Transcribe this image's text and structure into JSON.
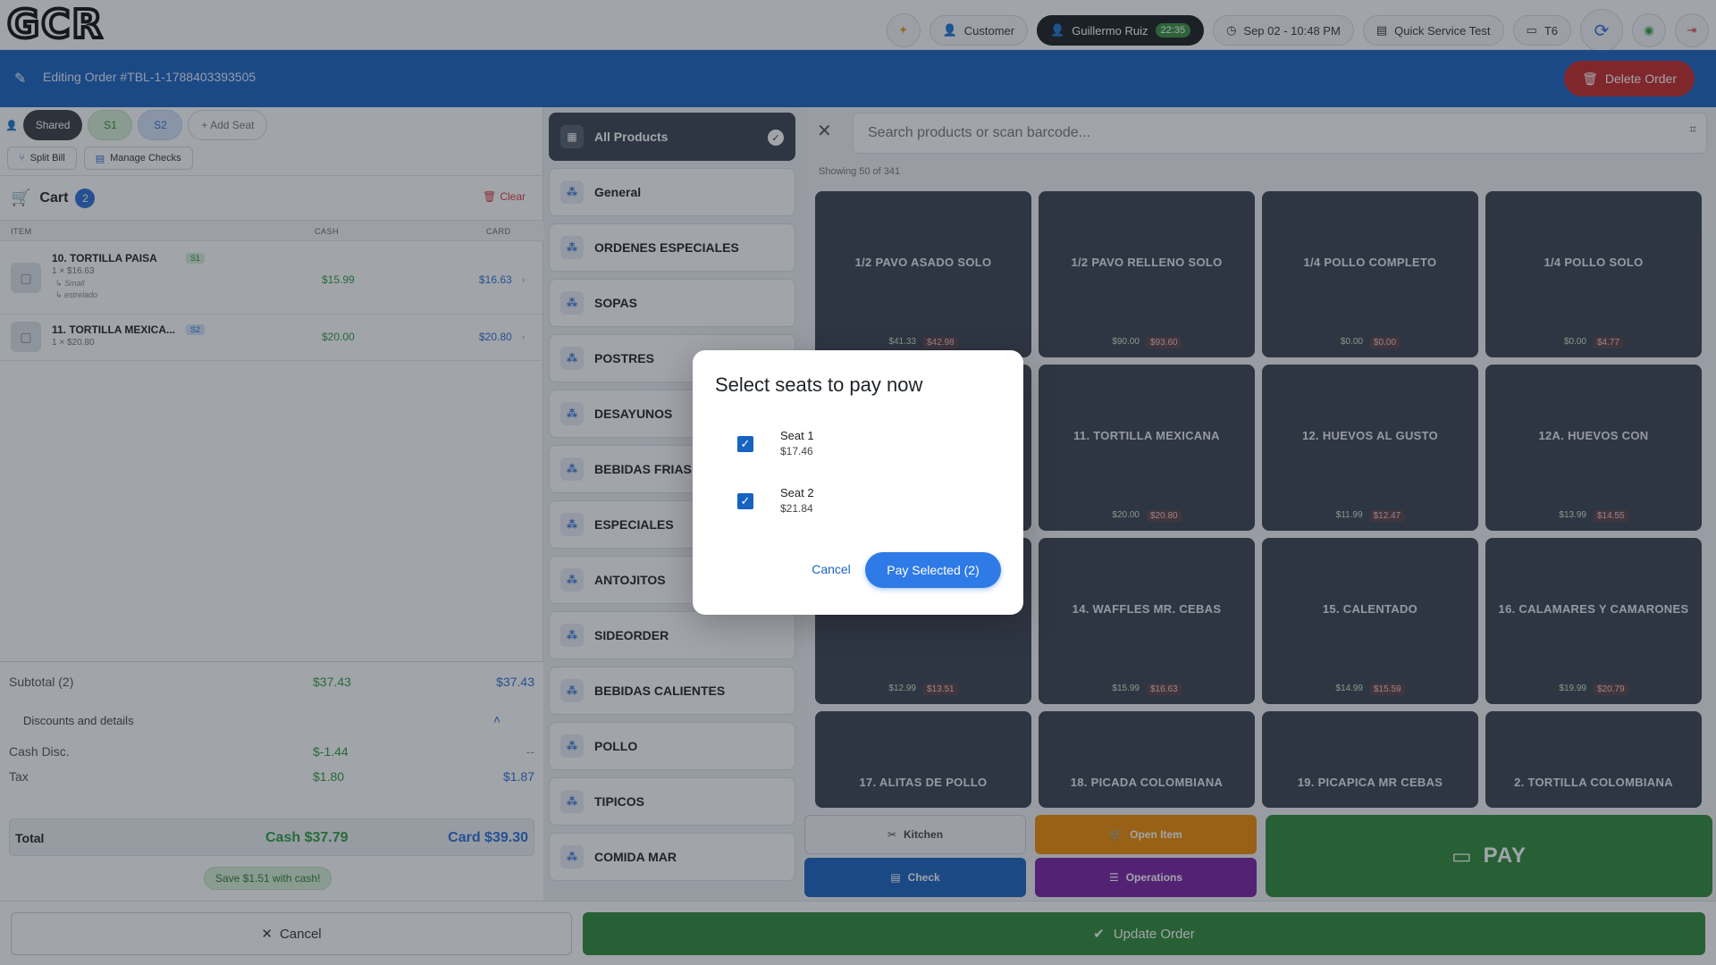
{
  "header": {
    "logo": "GCR",
    "customer_label": "Customer",
    "user_name": "Guillermo Ruiz",
    "user_time": "22:35",
    "datetime": "Sep 02 - 10:48 PM",
    "store": "Quick Service Test",
    "terminal": "T6"
  },
  "editbar": {
    "title": "Editing Order #TBL-1-1788403393505",
    "delete_label": "Delete Order"
  },
  "seats": {
    "shared": "Shared",
    "s1": "S1",
    "s2": "S2",
    "add": "+ Add Seat",
    "split_bill": "Split Bill",
    "manage_checks": "Manage Checks"
  },
  "cart": {
    "title": "Cart",
    "count": "2",
    "clear": "Clear",
    "col_item": "ITEM",
    "col_cash": "CASH",
    "col_card": "CARD",
    "items": [
      {
        "name": "10. TORTILLA PAISA",
        "seat": "S1",
        "qty_price": "1 × $16.63",
        "mods": [
          "↳ Small",
          "↳ estrelado"
        ],
        "cash": "$15.99",
        "card": "$16.63"
      },
      {
        "name": "11. TORTILLA MEXICA...",
        "seat": "S2",
        "qty_price": "1 × $20.80",
        "mods": [],
        "cash": "$20.00",
        "card": "$20.80"
      }
    ]
  },
  "totals": {
    "subtotal_label": "Subtotal (2)",
    "subtotal_cash": "$37.43",
    "subtotal_card": "$37.43",
    "discounts_label": "Discounts and details",
    "cash_disc_label": "Cash Disc.",
    "cash_disc_cash": "$-1.44",
    "cash_disc_card": "--",
    "tax_label": "Tax",
    "tax_cash": "$1.80",
    "tax_card": "$1.87",
    "total_label": "Total",
    "total_cash": "Cash $37.79",
    "total_card": "Card $39.30",
    "save_chip": "Save $1.51 with cash!"
  },
  "categories": {
    "all": "All Products",
    "items": [
      "General",
      "ORDENES ESPECIALES",
      "SOPAS",
      "POSTRES",
      "DESAYUNOS",
      "BEBIDAS FRIAS",
      "ESPECIALES",
      "ANTOJITOS",
      "SIDEORDER",
      "BEBIDAS CALIENTES",
      "POLLO",
      "TIPICOS",
      "COMIDA MAR"
    ]
  },
  "products": {
    "search_placeholder": "Search products or scan barcode...",
    "showing": "Showing 50 of 341",
    "tiles": [
      {
        "name": "1/2 PAVO ASADO SOLO",
        "cash": "$41.33",
        "card": "$42.98"
      },
      {
        "name": "1/2 PAVO RELLENO SOLO",
        "cash": "$90.00",
        "card": "$93.60"
      },
      {
        "name": "1/4 POLLO COMPLETO",
        "cash": "$0.00",
        "card": "$0.00"
      },
      {
        "name": "1/4 POLLO SOLO",
        "cash": "$0.00",
        "card": "$4.77"
      },
      {
        "name": "",
        "cash": "",
        "card": ""
      },
      {
        "name": "11. TORTILLA MEXICANA",
        "cash": "$20.00",
        "card": "$20.80"
      },
      {
        "name": "12. HUEVOS AL GUSTO",
        "cash": "$11.99",
        "card": "$12.47"
      },
      {
        "name": "12A. HUEVOS CON",
        "cash": "$13.99",
        "card": "$14.55"
      },
      {
        "name": "",
        "cash": "$12.99",
        "card": "$13.51"
      },
      {
        "name": "14. WAFFLES  MR. CEBAS",
        "cash": "$15.99",
        "card": "$16.63"
      },
      {
        "name": "15. CALENTADO",
        "cash": "$14.99",
        "card": "$15.59"
      },
      {
        "name": "16. CALAMARES Y CAMARONES",
        "cash": "$19.99",
        "card": "$20.79"
      },
      {
        "name": "17. ALITAS  DE POLLO",
        "cash": "",
        "card": ""
      },
      {
        "name": "18. PICADA COLOMBIANA",
        "cash": "",
        "card": ""
      },
      {
        "name": "19. PICAPICA MR CEBAS",
        "cash": "",
        "card": ""
      },
      {
        "name": "2. TORTILLA COLOMBIANA",
        "cash": "",
        "card": ""
      }
    ]
  },
  "actions": {
    "kitchen": "Kitchen",
    "open_item": "Open Item",
    "check": "Check",
    "operations": "Operations",
    "pay": "PAY"
  },
  "bottom": {
    "cancel": "Cancel",
    "update": "Update Order"
  },
  "modal": {
    "title": "Select seats to pay now",
    "seats": [
      {
        "label": "Seat 1",
        "amount": "$17.46",
        "checked": true
      },
      {
        "label": "Seat 2",
        "amount": "$21.84",
        "checked": true
      }
    ],
    "cancel": "Cancel",
    "pay_selected": "Pay Selected (2)"
  },
  "colors": {
    "brand_blue": "#1763c2",
    "pay_green": "#2e8b36",
    "danger_red": "#c62828",
    "tile_dark": "#3b4350"
  }
}
